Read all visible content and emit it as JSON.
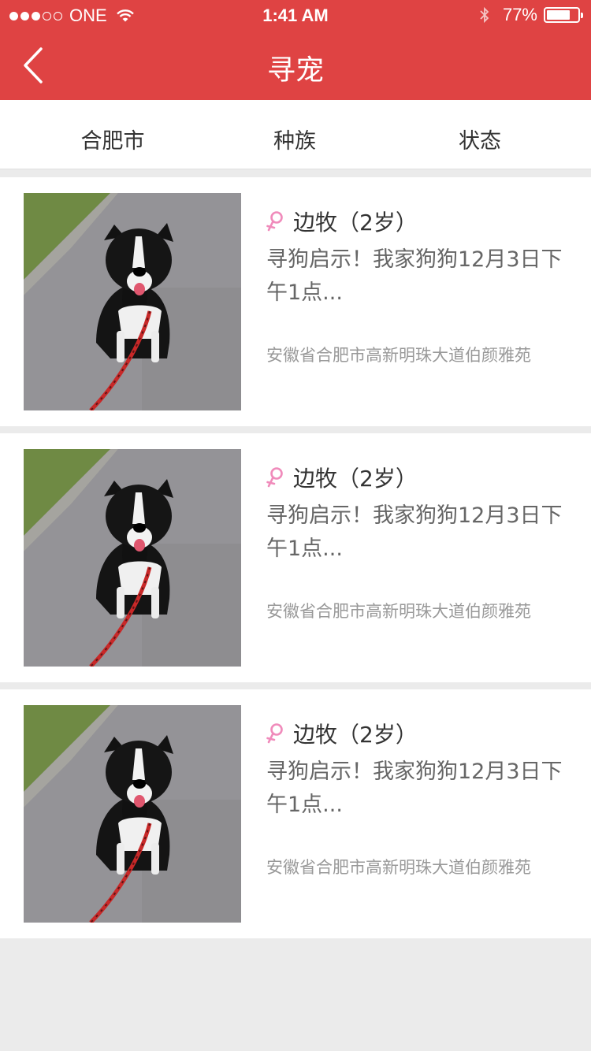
{
  "status_bar": {
    "carrier": "ONE",
    "time": "1:41 AM",
    "battery": "77%",
    "battery_level": 0.77
  },
  "header": {
    "title": "寻宠",
    "back_icon": "chevron-left-icon"
  },
  "filters": [
    {
      "label": "合肥市"
    },
    {
      "label": "种族"
    },
    {
      "label": "状态"
    }
  ],
  "listings": [
    {
      "gender_icon": "female-icon",
      "name": "边牧（2岁）",
      "description": "寻狗启示！我家狗狗12月3日下午1点...",
      "address": "安徽省合肥市高新明珠大道伯颜雅苑"
    },
    {
      "gender_icon": "female-icon",
      "name": "边牧（2岁）",
      "description": "寻狗启示！我家狗狗12月3日下午1点...",
      "address": "安徽省合肥市高新明珠大道伯颜雅苑"
    },
    {
      "gender_icon": "female-icon",
      "name": "边牧（2岁）",
      "description": "寻狗启示！我家狗狗12月3日下午1点...",
      "address": "安徽省合肥市高新明珠大道伯颜雅苑"
    }
  ],
  "colors": {
    "brand": "#df4343",
    "female": "#f08bbb"
  }
}
